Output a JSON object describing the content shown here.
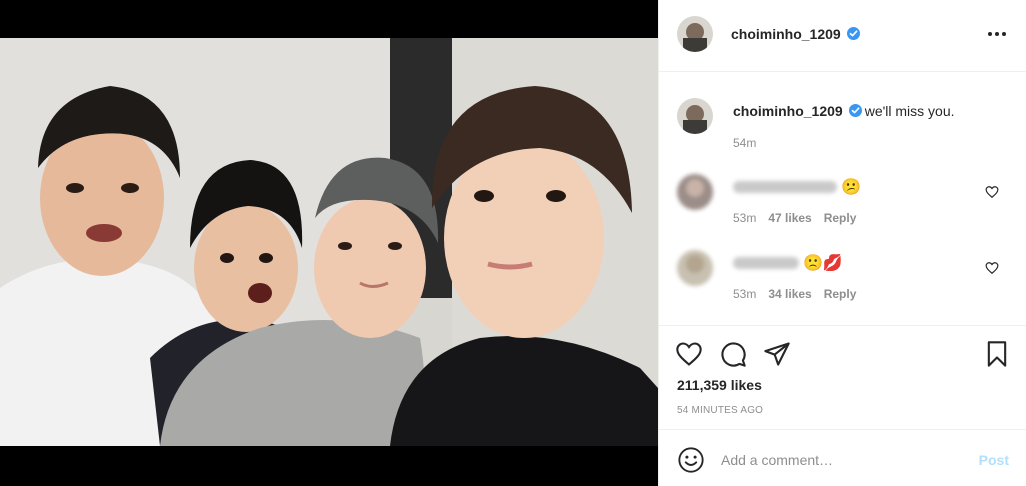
{
  "post": {
    "username": "choiminho_1209",
    "verified": true,
    "caption": "we'll miss you.",
    "caption_time": "54m"
  },
  "comments": [
    {
      "time": "53m",
      "likes": "47 likes",
      "reply": "Reply",
      "emoji": "😕"
    },
    {
      "time": "53m",
      "likes": "34 likes",
      "reply": "Reply",
      "emoji": "🙁💋"
    }
  ],
  "actions": {
    "likes": "211,359 likes",
    "timestamp": "54 MINUTES AGO"
  },
  "comment_box": {
    "placeholder": "Add a comment…",
    "post_label": "Post"
  },
  "colors": {
    "verified": "#3897f0",
    "post_disabled": "#b2dffc",
    "muted": "#8e8e8e"
  },
  "icons": [
    "more-icon",
    "verified-icon",
    "heart-icon",
    "comment-icon",
    "share-icon",
    "bookmark-icon",
    "smile-icon"
  ]
}
